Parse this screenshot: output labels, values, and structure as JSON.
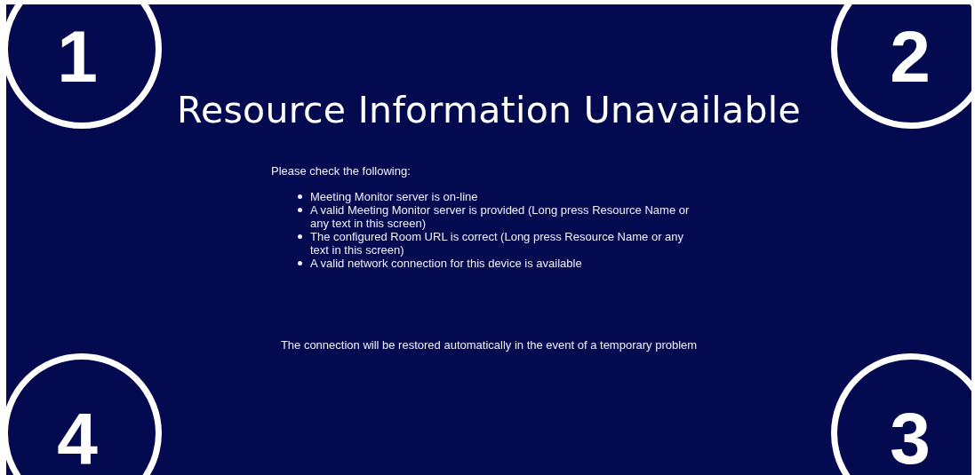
{
  "corner_markers": [
    {
      "label": "1"
    },
    {
      "label": "2"
    },
    {
      "label": "4"
    },
    {
      "label": "3"
    }
  ],
  "title": "Resource Information Unavailable",
  "intro": "Please check the following:",
  "checklist": [
    "Meeting Monitor server is on-line",
    "A valid Meeting Monitor server is provided (Long press Resource Name or any text in this screen)",
    "The configured Room URL is correct (Long press Resource Name or any text in this screen)",
    "A valid network connection for this device is available"
  ],
  "footer": "The connection will be restored automatically in the event of a temporary problem"
}
